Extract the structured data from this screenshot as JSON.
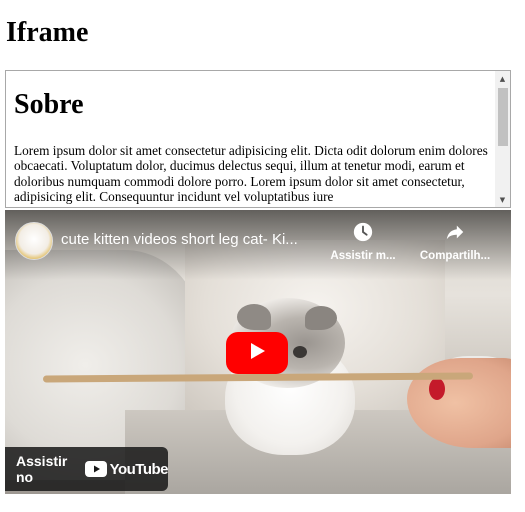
{
  "page": {
    "title": "Iframe"
  },
  "iframe_doc": {
    "heading": "Sobre",
    "paragraph": "Lorem ipsum dolor sit amet consectetur adipisicing elit. Dicta odit dolorum enim dolores obcaecati. Voluptatum dolor, ducimus delectus sequi, illum at tenetur modi, earum et doloribus numquam commodi dolore porro. Lorem ipsum dolor sit amet consectetur, adipisicing elit. Consequuntur incidunt vel voluptatibus iure"
  },
  "scrollbar": {
    "up_icon": "▲",
    "down_icon": "▼"
  },
  "video": {
    "title": "cute kitten videos short leg cat- Ki...",
    "watch_later_label": "Assistir m...",
    "share_label": "Compartilh...",
    "watch_on_label": "Assistir no",
    "youtube_wordmark": "YouTube",
    "colors": {
      "play_button": "#ff0000",
      "nail_polish": "#c41a2a"
    }
  }
}
